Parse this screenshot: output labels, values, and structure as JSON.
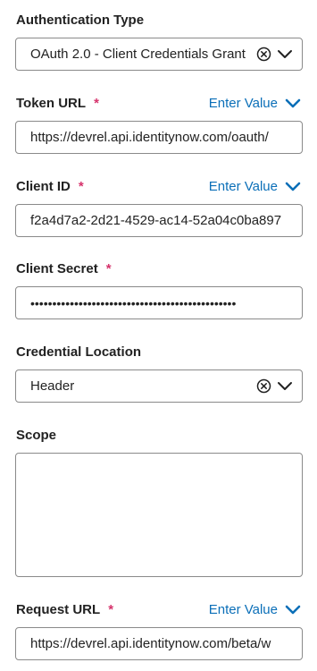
{
  "auth_type": {
    "label": "Authentication Type",
    "value": "OAuth 2.0 - Client Credentials Grant"
  },
  "token_url": {
    "label": "Token URL",
    "required_mark": "*",
    "enter_value": "Enter Value",
    "value": "https://devrel.api.identitynow.com/oauth/"
  },
  "client_id": {
    "label": "Client ID",
    "required_mark": "*",
    "enter_value": "Enter Value",
    "value": "f2a4d7a2-2d21-4529-ac14-52a04c0ba897"
  },
  "client_secret": {
    "label": "Client Secret",
    "required_mark": "*",
    "value": "•••••••••••••••••••••••••••••••••••••••••••••••"
  },
  "credential_location": {
    "label": "Credential Location",
    "value": "Header"
  },
  "scope": {
    "label": "Scope",
    "value": ""
  },
  "request_url": {
    "label": "Request URL",
    "required_mark": "*",
    "enter_value": "Enter Value",
    "value": "https://devrel.api.identitynow.com/beta/w"
  },
  "colors": {
    "accent": "#0b6fb8",
    "required": "#d6336c",
    "border": "#8a8a8a"
  }
}
